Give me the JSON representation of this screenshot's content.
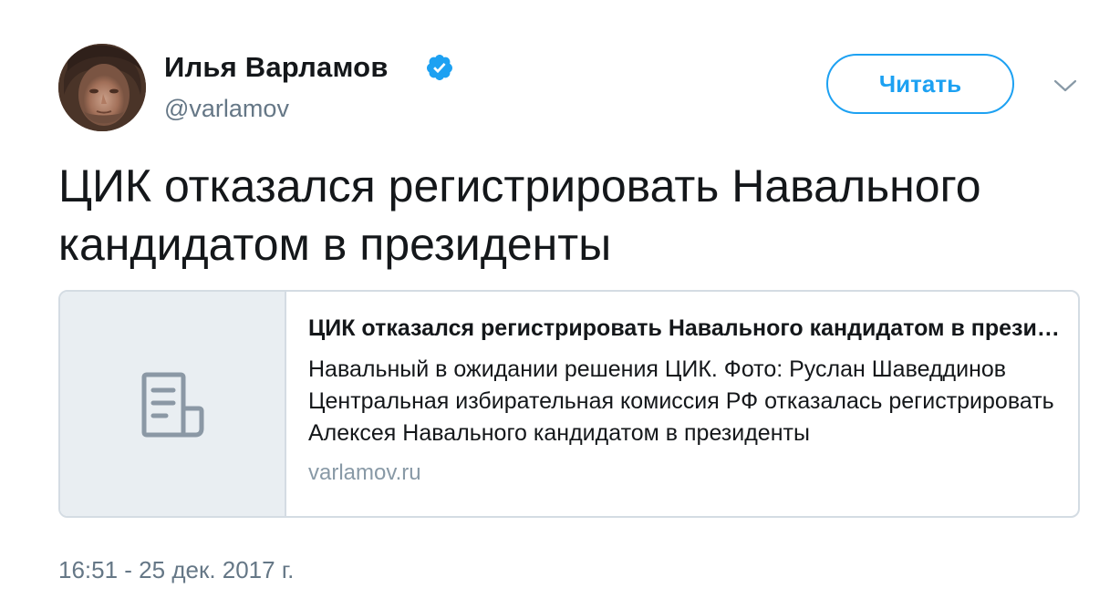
{
  "author": {
    "name": "Илья Варламов",
    "handle": "@varlamov",
    "verified": true,
    "avatar_icon": "user-avatar-photo"
  },
  "follow_button": {
    "label": "Читать"
  },
  "menu_icon": "chevron-down-icon",
  "tweet": {
    "text": "ЦИК отказался регистрировать Навального кандидатом в президенты"
  },
  "card": {
    "image_icon": "document-icon",
    "title": "ЦИК отказался регистрировать Навального кандидатом в президенты",
    "description": "Навальный в ожидании решения ЦИК. Фото: Руслан Шаведдинов Центральная избирательная комиссия РФ отказалась регистрировать Алексея Навального кандидатом в президенты",
    "domain": "varlamov.ru"
  },
  "timestamp": "16:51 - 25 дек. 2017 г.",
  "colors": {
    "accent": "#1da1f2",
    "text": "#14171a",
    "secondary_text": "#657786",
    "border": "#d4dce3",
    "card_image_bg": "#e9eef2"
  }
}
